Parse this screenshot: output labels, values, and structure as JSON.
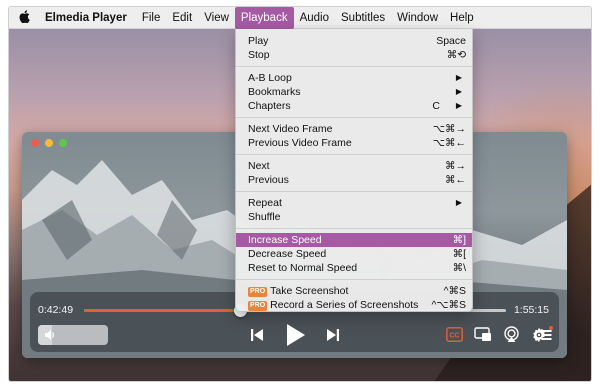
{
  "menubar": {
    "apple": "",
    "items": [
      "Elmedia Player",
      "File",
      "Edit",
      "View",
      "Playback",
      "Audio",
      "Subtitles",
      "Window",
      "Help"
    ],
    "active": "Playback"
  },
  "playback_menu": {
    "play": {
      "label": "Play",
      "shortcut": "Space"
    },
    "stop": {
      "label": "Stop",
      "shortcut": "⌘⟲"
    },
    "ab_loop": {
      "label": "A-B Loop",
      "submenu": "▶"
    },
    "bookmarks": {
      "label": "Bookmarks",
      "submenu": "▶"
    },
    "chapters": {
      "label": "Chapters",
      "shortcut": "C",
      "submenu": "▶"
    },
    "next_frame": {
      "label": "Next Video Frame",
      "shortcut": "⌥⌘→"
    },
    "prev_frame": {
      "label": "Previous Video Frame",
      "shortcut": "⌥⌘←"
    },
    "next": {
      "label": "Next",
      "shortcut": "⌘→"
    },
    "previous": {
      "label": "Previous",
      "shortcut": "⌘←"
    },
    "repeat": {
      "label": "Repeat",
      "submenu": "▶"
    },
    "shuffle": {
      "label": "Shuffle"
    },
    "increase_speed": {
      "label": "Increase Speed",
      "shortcut": "⌘]"
    },
    "decrease_speed": {
      "label": "Decrease Speed",
      "shortcut": "⌘["
    },
    "reset_speed": {
      "label": "Reset to Normal Speed",
      "shortcut": "⌘\\"
    },
    "screenshot": {
      "badge": "PRO",
      "label": "Take Screenshot",
      "shortcut": "^⌘S"
    },
    "screenshot_series": {
      "badge": "PRO",
      "label": "Record a Series of Screenshots",
      "shortcut": "^⌥⌘S"
    }
  },
  "player": {
    "time_elapsed": "0:42:49",
    "time_remaining": "1:55:15",
    "progress": 0.37,
    "volume": 0.2,
    "cc_label": "CC",
    "colors": {
      "accent": "#a55aa3",
      "progress": "#e0603a",
      "cc": "#e0603a"
    }
  }
}
